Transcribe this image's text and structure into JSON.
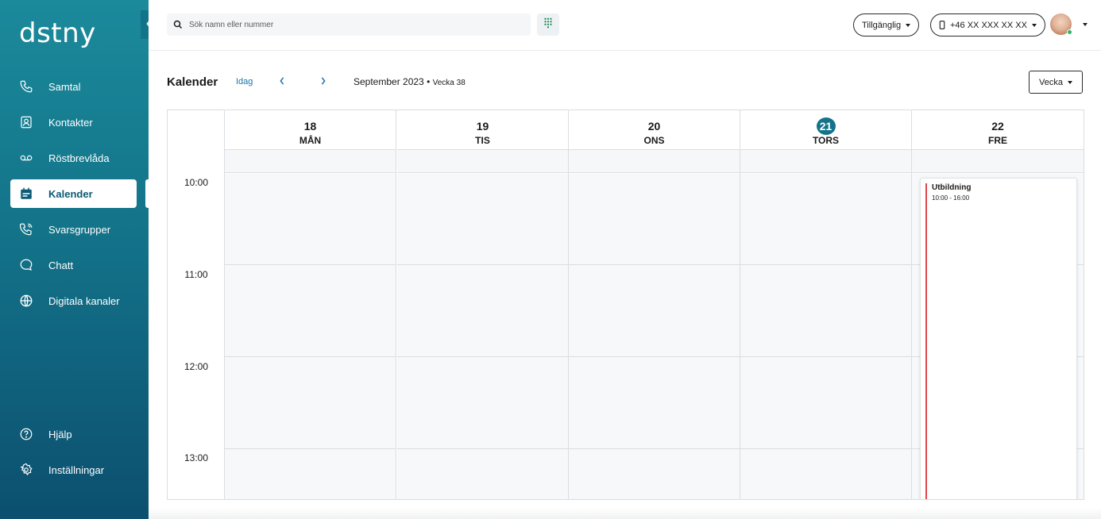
{
  "app": {
    "logo": "dstny"
  },
  "sidebar": {
    "items": [
      {
        "label": "Samtal",
        "icon": "phone-icon"
      },
      {
        "label": "Kontakter",
        "icon": "contact-icon"
      },
      {
        "label": "Röstbrevlåda",
        "icon": "voicemail-icon"
      },
      {
        "label": "Kalender",
        "icon": "calendar-icon",
        "active": true
      },
      {
        "label": "Svarsgrupper",
        "icon": "group-phone-icon"
      },
      {
        "label": "Chatt",
        "icon": "chat-icon"
      },
      {
        "label": "Digitala kanaler",
        "icon": "globe-icon"
      }
    ],
    "bottom_items": [
      {
        "label": "Hjälp",
        "icon": "help-icon"
      },
      {
        "label": "Inställningar",
        "icon": "gear-icon"
      }
    ]
  },
  "topbar": {
    "search_placeholder": "Sök namn eller nummer",
    "status_label": "Tillgänglig",
    "phone_label": "+46 XX XXX XX XX"
  },
  "calendar": {
    "title": "Kalender",
    "today_label": "Idag",
    "period": "September 2023",
    "separator": "•",
    "week_label": "Vecka 38",
    "view_label": "Vecka",
    "days": [
      {
        "num": "18",
        "name": "MÅN"
      },
      {
        "num": "19",
        "name": "TIS"
      },
      {
        "num": "20",
        "name": "ONS"
      },
      {
        "num": "21",
        "name": "TORS",
        "today": true
      },
      {
        "num": "22",
        "name": "FRE"
      }
    ],
    "hours": [
      "10:00",
      "11:00",
      "12:00",
      "13:00"
    ],
    "event": {
      "title": "Utbildning",
      "time": "10:00 - 16:00",
      "day": "22",
      "accent": "#e0474c"
    }
  },
  "colors": {
    "brand": "#137389",
    "accent_link": "#1776a8",
    "status_online": "#2bb673"
  }
}
